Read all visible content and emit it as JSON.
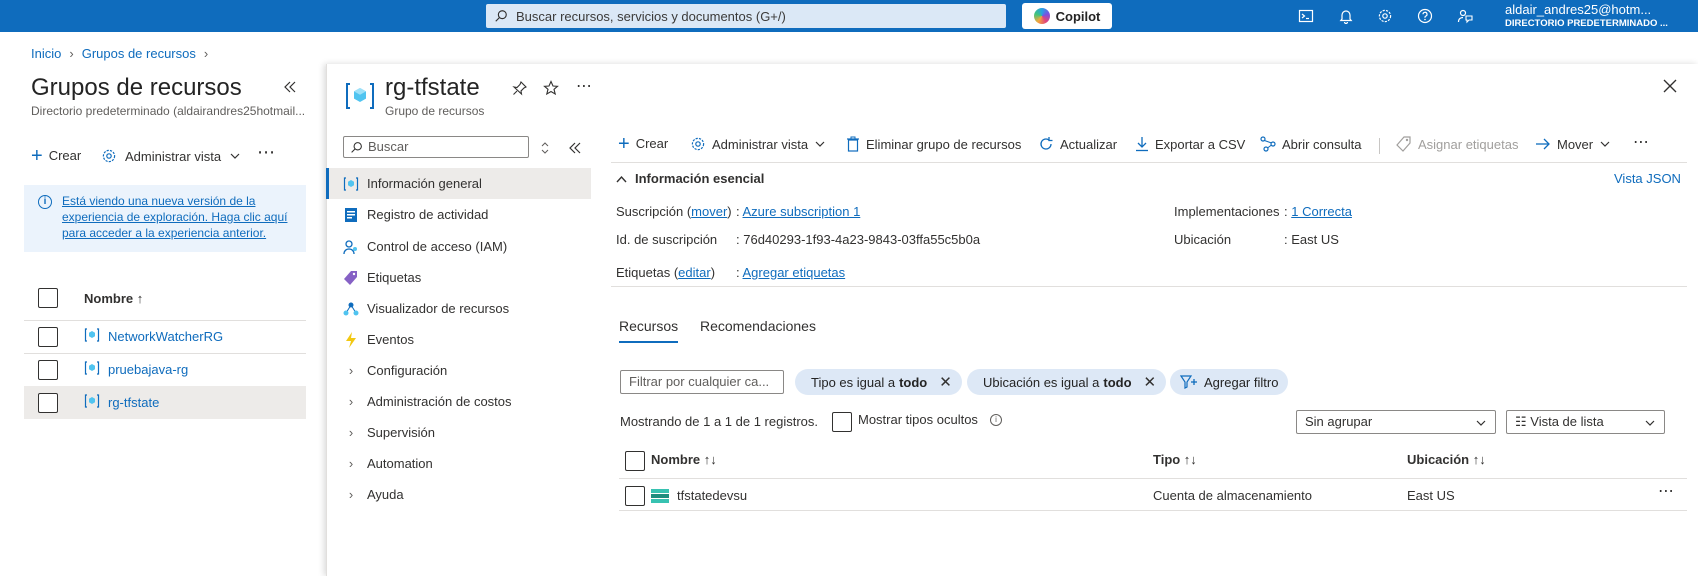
{
  "topbar": {
    "search_placeholder": "Buscar recursos, servicios y documentos (G+/)",
    "copilot_label": "Copilot",
    "icons": [
      "terminal-icon",
      "bell-icon",
      "gear-icon",
      "help-icon",
      "feedback-icon"
    ],
    "user_name": "aldair_andres25@hotm...",
    "user_directory": "DIRECTORIO PREDETERMINADO ..."
  },
  "breadcrumb": [
    "Inicio",
    "Grupos de recursos"
  ],
  "left_pane": {
    "title": "Grupos de recursos",
    "subtitle": "Directorio predeterminado (aldairandres25hotmail...",
    "create_label": "Crear",
    "manage_view_label": "Administrar vista",
    "more_label": "⋯",
    "info_text": "Está viendo una nueva versión de la experiencia de exploración. Haga clic aquí para acceder a la experiencia anterior.",
    "info_line1": "Está viendo una nueva versión de la",
    "info_line2": "experiencia de exploración. Haga clic aquí",
    "info_line3": "para acceder a la experiencia anterior.",
    "column_name": "Nombre ↑",
    "rows": [
      {
        "name": "NetworkWatcherRG",
        "selected": false
      },
      {
        "name": "pruebajava-rg",
        "selected": false
      },
      {
        "name": "rg-tfstate",
        "selected": true
      }
    ]
  },
  "blade": {
    "title": "rg-tfstate",
    "subtitle": "Grupo de recursos",
    "menu_search_placeholder": "Buscar",
    "menu": [
      {
        "label": "Información general",
        "icon": "overview-icon",
        "active": true,
        "expandable": false
      },
      {
        "label": "Registro de actividad",
        "icon": "activity-log-icon",
        "active": false,
        "expandable": false
      },
      {
        "label": "Control de acceso (IAM)",
        "icon": "iam-icon",
        "active": false,
        "expandable": false
      },
      {
        "label": "Etiquetas",
        "icon": "tag-icon",
        "active": false,
        "expandable": false
      },
      {
        "label": "Visualizador de recursos",
        "icon": "resource-visualizer-icon",
        "active": false,
        "expandable": false
      },
      {
        "label": "Eventos",
        "icon": "events-icon",
        "active": false,
        "expandable": false
      },
      {
        "label": "Configuración",
        "active": false,
        "expandable": true
      },
      {
        "label": "Administración de costos",
        "active": false,
        "expandable": true
      },
      {
        "label": "Supervisión",
        "active": false,
        "expandable": true
      },
      {
        "label": "Automation",
        "active": false,
        "expandable": true
      },
      {
        "label": "Ayuda",
        "active": false,
        "expandable": true
      }
    ],
    "toolbar": {
      "create": "Crear",
      "manage_view": "Administrar vista",
      "delete_group": "Eliminar grupo de recursos",
      "refresh": "Actualizar",
      "export_csv": "Exportar a CSV",
      "open_query": "Abrir consulta",
      "assign_tags": "Asignar etiquetas",
      "move": "Mover",
      "more": "⋯"
    },
    "essentials": {
      "header": "Información esencial",
      "json_view": "Vista JSON",
      "subscription_label": "Suscripción",
      "subscription_link": "mover",
      "subscription_value": "Azure subscription 1",
      "subscription_id_label": "Id. de suscripción",
      "subscription_id_value": "76d40293-1f93-4a23-9843-03ffa55c5b0a",
      "tags_label": "Etiquetas",
      "tags_link": "editar",
      "tags_value": "Agregar etiquetas",
      "deployments_label": "Implementaciones",
      "deployments_value": "1 Correcta",
      "location_label": "Ubicación",
      "location_value": "East US"
    },
    "tabs": [
      {
        "label": "Recursos",
        "active": true
      },
      {
        "label": "Recomendaciones",
        "active": false
      }
    ],
    "filters": {
      "input_placeholder": "Filtrar por cualquier ca...",
      "type_pill_prefix": "Tipo es igual a",
      "type_pill_value": "todo",
      "location_pill_prefix": "Ubicación es igual a",
      "location_pill_value": "todo",
      "add_filter": "Agregar filtro"
    },
    "showing_text": "Mostrando de 1 a 1 de 1 registros.",
    "show_hidden_label": "Mostrar tipos ocultos",
    "group_by_value": "Sin agrupar",
    "view_value": "☷ Vista de lista",
    "grid": {
      "columns": [
        "Nombre ↑↓",
        "Tipo ↑↓",
        "Ubicación ↑↓"
      ],
      "rows": [
        {
          "name": "tfstatedevsu",
          "type": "Cuenta de almacenamiento",
          "location": "East US"
        }
      ],
      "row_more": "⋯"
    }
  }
}
